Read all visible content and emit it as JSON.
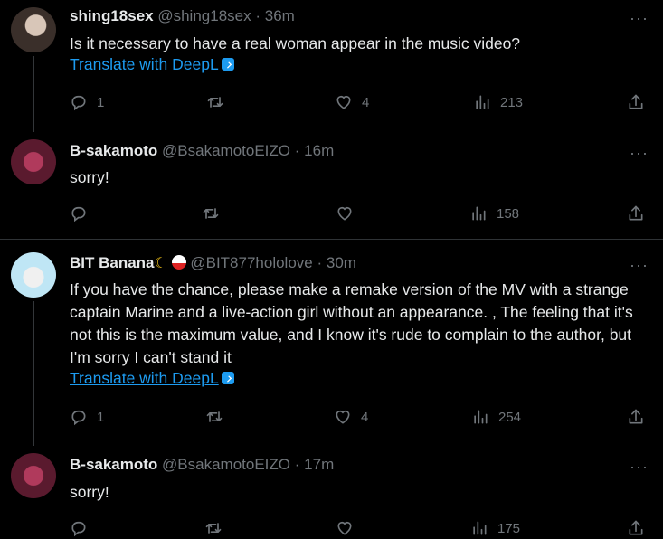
{
  "tweets": [
    {
      "name": "shing18sex",
      "handle": "@shing18sex",
      "dot": "·",
      "time": "36m",
      "more": "···",
      "text": "Is it necessary to have a real woman appear in the music video?",
      "translate": "Translate with DeepL",
      "replies": "1",
      "retweets": "",
      "likes": "4",
      "views": "213",
      "avatar_colors": [
        "#3a2f2a",
        "#d8c6b8"
      ]
    },
    {
      "name": "B-sakamoto",
      "handle": "@BsakamotoEIZO",
      "dot": "·",
      "time": "16m",
      "more": "···",
      "text": "sorry!",
      "replies": "",
      "retweets": "",
      "likes": "",
      "views": "158",
      "avatar_colors": [
        "#5a1a2e",
        "#b03a5c"
      ]
    },
    {
      "name": "BIT Banana",
      "handle": "@BIT877hololove",
      "dot": "·",
      "time": "30m",
      "more": "···",
      "text": "If you have the chance, please make a remake version of the MV with a strange captain Marine and a live-action girl without an appearance. , The feeling that it's not this is the maximum value, and I know it's rude to complain to the author, but I'm sorry I can't stand it",
      "translate": "Translate with DeepL",
      "replies": "1",
      "retweets": "",
      "likes": "4",
      "views": "254",
      "avatar_colors": [
        "#bfe6f5",
        "#f0f0f0"
      ]
    },
    {
      "name": "B-sakamoto",
      "handle": "@BsakamotoEIZO",
      "dot": "·",
      "time": "17m",
      "more": "···",
      "text": "sorry!",
      "replies": "",
      "retweets": "",
      "likes": "",
      "views": "175",
      "avatar_colors": [
        "#5a1a2e",
        "#b03a5c"
      ]
    }
  ],
  "icons": {
    "reply": "reply-icon",
    "retweet": "retweet-icon",
    "like": "heart-icon",
    "views": "views-icon",
    "share": "share-icon",
    "more": "more-icon",
    "deepl": "deepl-icon",
    "banana_emoji": "banana-emoji",
    "rice_emoji": "rice-emoji"
  },
  "colors": {
    "link": "#1d9bf0",
    "muted": "#71767b",
    "text": "#e7e9ea",
    "bg": "#000000"
  }
}
